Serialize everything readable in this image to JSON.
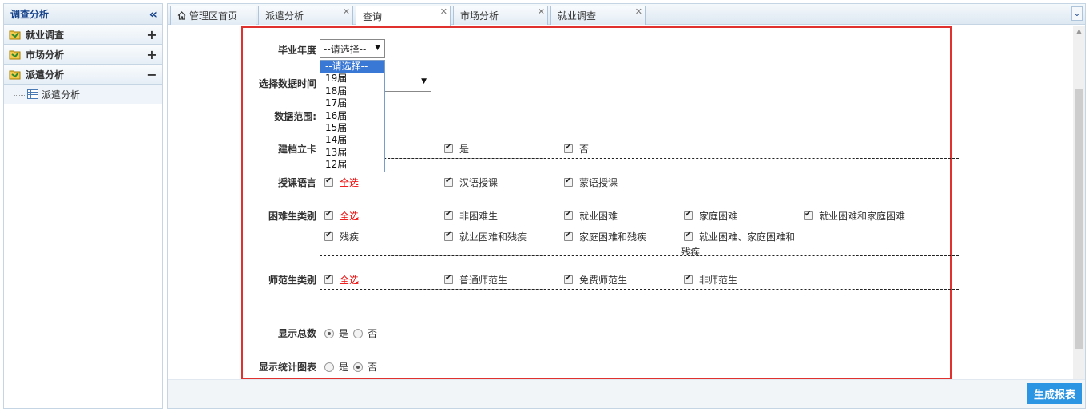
{
  "sidebar": {
    "title": "调查分析",
    "items": [
      {
        "label": "就业调查",
        "toggle": "+"
      },
      {
        "label": "市场分析",
        "toggle": "+"
      },
      {
        "label": "派遣分析",
        "toggle": "−"
      }
    ],
    "sub_items": [
      {
        "label": "派遣分析"
      }
    ]
  },
  "tabs": [
    {
      "label": "管理区首页",
      "closable": false
    },
    {
      "label": "派遣分析",
      "closable": true
    },
    {
      "label": "查询",
      "closable": true,
      "active": true
    },
    {
      "label": "市场分析",
      "closable": true
    },
    {
      "label": "就业调查",
      "closable": true
    }
  ],
  "form": {
    "grad_year": {
      "label": "毕业年度",
      "selected": "--请选择--",
      "options": [
        "--请选择--",
        "19届",
        "18届",
        "17届",
        "16届",
        "15届",
        "14届",
        "13届",
        "12届"
      ]
    },
    "data_time": {
      "label": "选择数据时间"
    },
    "data_range": {
      "label": "数据范围:"
    },
    "archive": {
      "label": "建档立卡",
      "options": [
        "是",
        "否"
      ]
    },
    "language": {
      "label": "授课语言",
      "options": [
        "全选",
        "汉语授课",
        "蒙语授课"
      ]
    },
    "difficulty": {
      "label": "困难生类别",
      "options": [
        "全选",
        "非困难生",
        "就业困难",
        "家庭困难",
        "就业困难和家庭困难",
        "残疾",
        "就业困难和残疾",
        "家庭困难和残疾",
        "就业困难、家庭困难和",
        "残疾"
      ]
    },
    "normal": {
      "label": "师范生类别",
      "options": [
        "全选",
        "普通师范生",
        "免费师范生",
        "非师范生"
      ]
    },
    "show_total": {
      "label": "显示总数",
      "yes": "是",
      "no": "否",
      "value": "是"
    },
    "show_chart": {
      "label": "显示统计图表",
      "yes": "是",
      "no": "否",
      "value": "否"
    }
  },
  "buttons": {
    "generate": "生成报表"
  },
  "colors": {
    "accent": "#2b95e3",
    "frame": "#e1312f",
    "select_all": "#e00000"
  }
}
